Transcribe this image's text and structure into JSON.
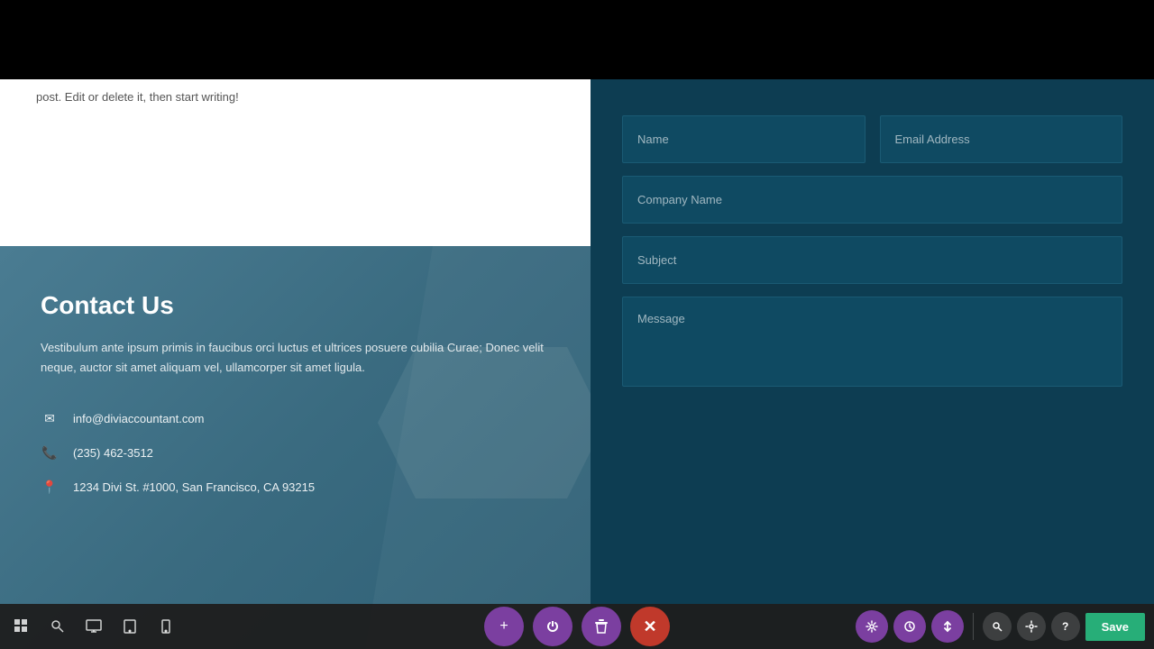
{
  "topBar": {
    "background": "#000000"
  },
  "leftWhite": {
    "text": "post. Edit or delete it, then start writing!"
  },
  "leftContact": {
    "title": "Contact Us",
    "description": "Vestibulum ante ipsum primis in faucibus orci luctus et ultrices posuere cubilia Curae; Donec velit neque, auctor sit amet aliquam vel, ullamcorper sit amet ligula.",
    "email": "info@diviaccountant.com",
    "phone": "(235) 462-3512",
    "address": "1234 Divi St. #1000, San Francisco, CA 93215"
  },
  "form": {
    "namePlaceholder": "Name",
    "emailPlaceholder": "Email Address",
    "companyPlaceholder": "Company Name",
    "subjectPlaceholder": "Subject",
    "messagePlaceholder": "Message"
  },
  "toolbar": {
    "icons": [
      "grid-icon",
      "search-icon",
      "desktop-icon",
      "tablet-icon",
      "mobile-icon"
    ],
    "buttons": {
      "add": "+",
      "power": "⏻",
      "delete": "🗑",
      "close": "✕",
      "settings": "⚙",
      "history": "⏱",
      "sort": "⇅",
      "search": "🔍",
      "options": "⚙",
      "help": "?",
      "save": "Save"
    }
  }
}
